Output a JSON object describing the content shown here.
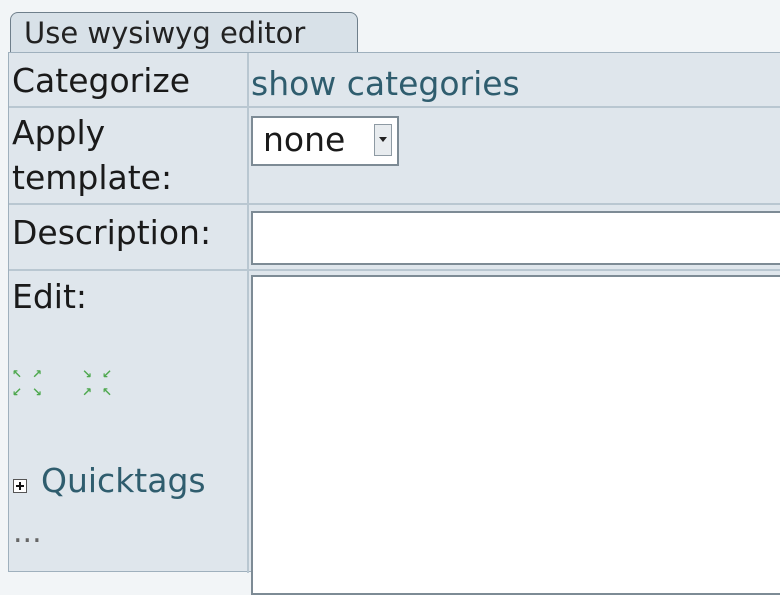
{
  "tab": {
    "label": "Use wysiwyg editor"
  },
  "form": {
    "categorize_label": "Categorize",
    "categorize_link": "show categories",
    "apply_template_label_line1": "Apply",
    "apply_template_label_line2": "template:",
    "template_selected": "none",
    "description_label": "Description:",
    "description_value": "",
    "edit_label": "Edit:",
    "edit_value": "",
    "quicktags_label": "Quicktags",
    "ellipsis": "..."
  },
  "icons": {
    "expand": "expand-arrows-icon",
    "collapse": "collapse-arrows-icon",
    "plus": "plus-box-icon",
    "dropdown": "chevron-down-icon"
  },
  "colors": {
    "link": "#2f5d6e",
    "panel": "#dfe6ec",
    "icon": "#4ea84e"
  }
}
